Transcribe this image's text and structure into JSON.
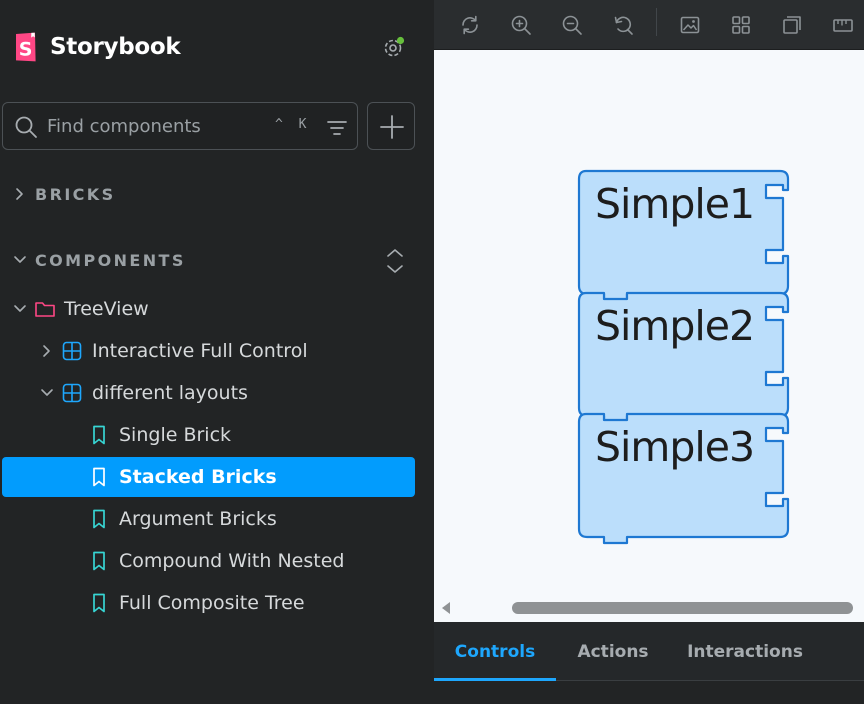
{
  "app": {
    "name": "Storybook"
  },
  "colors": {
    "accent": "#029cfd",
    "brand": "#ff4785",
    "story_icon": "#37d5d3",
    "component_icon": "#1ea7fd",
    "notification_dot": "#66bf3c"
  },
  "search": {
    "placeholder": "Find components",
    "shortcut": "^ K"
  },
  "sections": [
    {
      "label": "BRICKS",
      "expanded": false
    },
    {
      "label": "COMPONENTS",
      "expanded": true
    }
  ],
  "tree": {
    "folder": "TreeView",
    "components": [
      {
        "label": "Interactive Full Control",
        "expanded": false
      },
      {
        "label": "different layouts",
        "expanded": true
      }
    ],
    "stories": [
      {
        "label": "Single Brick"
      },
      {
        "label": "Stacked Bricks",
        "selected": true
      },
      {
        "label": "Argument Bricks"
      },
      {
        "label": "Compound With Nested"
      },
      {
        "label": "Full Composite Tree"
      }
    ]
  },
  "toolbar": {
    "tools": [
      "reload-icon",
      "zoom-in-icon",
      "zoom-out-icon",
      "zoom-reset-icon",
      "background-icon",
      "grid-icon",
      "outline-icon",
      "measure-icon"
    ]
  },
  "preview": {
    "bricks": [
      {
        "label": "Simple1"
      },
      {
        "label": "Simple2"
      },
      {
        "label": "Simple3"
      }
    ],
    "brick_fill": "#bbdefb",
    "brick_stroke": "#1e78d2"
  },
  "addons": {
    "tabs": [
      {
        "label": "Controls",
        "active": true
      },
      {
        "label": "Actions"
      },
      {
        "label": "Interactions"
      }
    ]
  }
}
